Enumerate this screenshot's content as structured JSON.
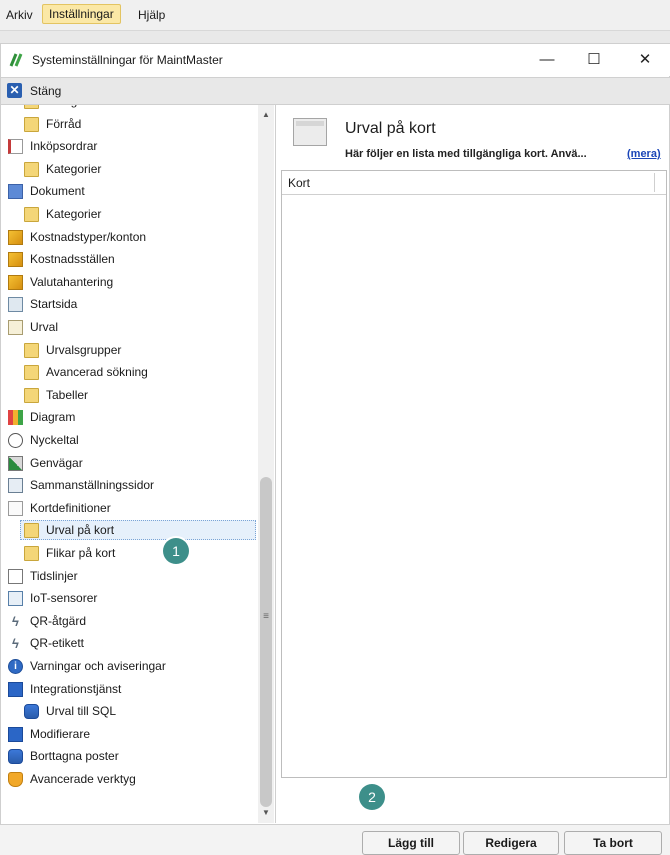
{
  "menubar": {
    "items": [
      "Arkiv",
      "Inställningar",
      "Hjälp"
    ],
    "active": "Inställningar"
  },
  "window": {
    "title": "Systeminställningar för MaintMaster",
    "controls": {
      "minimize": "—",
      "maximize": "☐",
      "close": "✕"
    }
  },
  "toolbar": {
    "close_label": "Stäng"
  },
  "tree": [
    {
      "label": "Kategorier",
      "icon": "folder-icon",
      "indent": 1
    },
    {
      "label": "Förråd",
      "icon": "folder-icon",
      "indent": 1
    },
    {
      "label": "Inköpsordrar",
      "icon": "purchase-order-icon",
      "indent": 0
    },
    {
      "label": "Kategorier",
      "icon": "folder-icon",
      "indent": 1
    },
    {
      "label": "Dokument",
      "icon": "document-icon",
      "indent": 0
    },
    {
      "label": "Kategorier",
      "icon": "folder-icon",
      "indent": 1
    },
    {
      "label": "Kostnadstyper/konton",
      "icon": "coins-icon",
      "indent": 0
    },
    {
      "label": "Kostnadsställen",
      "icon": "coins-icon",
      "indent": 0
    },
    {
      "label": "Valutahantering",
      "icon": "coins-icon",
      "indent": 0
    },
    {
      "label": "Startsida",
      "icon": "house-icon",
      "indent": 0
    },
    {
      "label": "Urval",
      "icon": "list-icon",
      "indent": 0
    },
    {
      "label": "Urvalsgrupper",
      "icon": "folder-icon",
      "indent": 1
    },
    {
      "label": "Avancerad sökning",
      "icon": "folder-icon",
      "indent": 1
    },
    {
      "label": "Tabeller",
      "icon": "folder-icon",
      "indent": 1
    },
    {
      "label": "Diagram",
      "icon": "bar-chart-icon",
      "indent": 0
    },
    {
      "label": "Nyckeltal",
      "icon": "gauge-icon",
      "indent": 0
    },
    {
      "label": "Genvägar",
      "icon": "shortcut-icon",
      "indent": 0
    },
    {
      "label": "Sammanställningssidor",
      "icon": "summary-page-icon",
      "indent": 0
    },
    {
      "label": "Kortdefinitioner",
      "icon": "card-icon",
      "indent": 0
    },
    {
      "label": "Urval på kort",
      "icon": "folder-icon",
      "indent": 1,
      "selected": true
    },
    {
      "label": "Flikar på kort",
      "icon": "folder-icon",
      "indent": 1
    },
    {
      "label": "Tidslinjer",
      "icon": "timeline-icon",
      "indent": 0
    },
    {
      "label": "IoT-sensorer",
      "icon": "sensor-icon",
      "indent": 0
    },
    {
      "label": "QR-åtgärd",
      "icon": "lightning-icon",
      "indent": 0
    },
    {
      "label": "QR-etikett",
      "icon": "lightning-icon",
      "indent": 0
    },
    {
      "label": "Varningar och aviseringar",
      "icon": "info-icon",
      "indent": 0
    },
    {
      "label": "Integrationstjänst",
      "icon": "puzzle-icon",
      "indent": 0
    },
    {
      "label": "Urval till SQL",
      "icon": "database-icon",
      "indent": 1
    },
    {
      "label": "Modifierare",
      "icon": "puzzle-icon",
      "indent": 0
    },
    {
      "label": "Borttagna poster",
      "icon": "database-icon",
      "indent": 0
    },
    {
      "label": "Avancerade verktyg",
      "icon": "shield-icon",
      "indent": 0
    }
  ],
  "panel": {
    "title": "Urval på kort",
    "description": "Här följer en lista med tillgängliga kort. Anvä...",
    "more_link": "(mera)",
    "column_header": "Kort",
    "buttons": {
      "add": "Lägg till",
      "edit": "Redigera",
      "remove": "Ta bort"
    }
  },
  "callouts": [
    "1",
    "2"
  ],
  "colors": {
    "callout": "#3d8f8a",
    "selection": "#e6f0fb",
    "folder": "#f4d678",
    "link": "#1a45b8"
  }
}
